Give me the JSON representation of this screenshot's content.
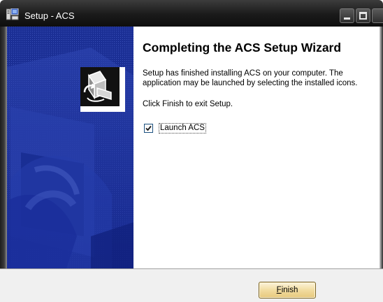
{
  "window": {
    "title": "Setup - ACS"
  },
  "wizard": {
    "heading": "Completing the ACS Setup Wizard",
    "description": "Setup has finished installing ACS on your computer. The application may be launched by selecting the installed icons.",
    "finish_instruction": "Click Finish to exit Setup.",
    "launch_checkbox": {
      "label": "Launch ACS",
      "checked": true
    }
  },
  "buttons": {
    "finish_mnemonic": "F",
    "finish_rest": "inish"
  },
  "colors": {
    "banner_blue": "#1f35a0",
    "title_bar": "#1a1a1a"
  }
}
